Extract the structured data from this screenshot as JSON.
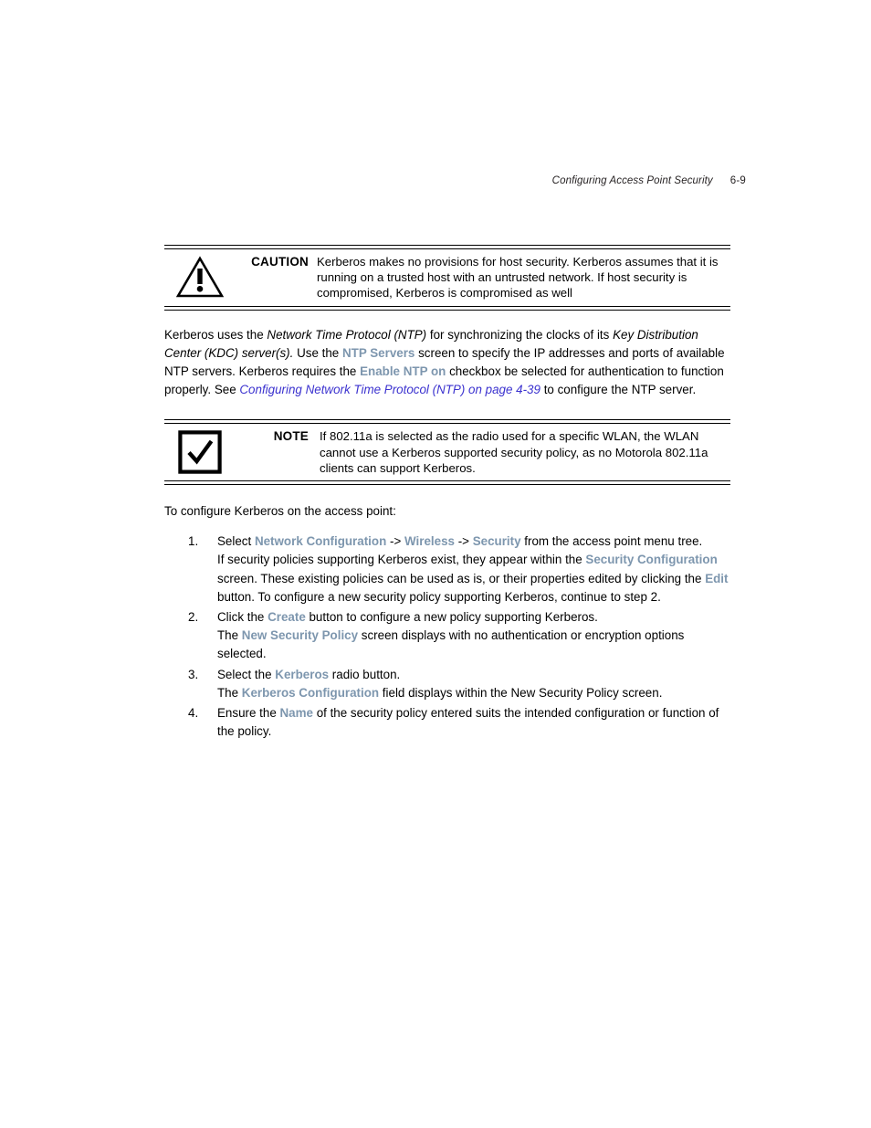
{
  "header": {
    "chapter_title": "Configuring Access Point Security",
    "page_number": "6-9"
  },
  "colors": {
    "ui_term": "#7d96ae",
    "cross_reference": "#3b32cf",
    "text": "#000000",
    "rule": "#000000"
  },
  "caution": {
    "icon": "warning-triangle-icon",
    "label": "CAUTION",
    "text": "Kerberos makes no provisions for host security. Kerberos assumes that it is running on a trusted host with an untrusted network. If host security is compromised, Kerberos is compromised as well"
  },
  "note": {
    "icon": "checkmark-box-icon",
    "label": "NOTE",
    "text": "If 802.11a is selected as the radio used for a specific WLAN, the WLAN cannot use a Kerberos supported security policy, as no Motorola 802.11a clients can support Kerberos."
  },
  "ntp_paragraph": {
    "seg1": "Kerberos uses the ",
    "em1": "Network Time Protocol (NTP)",
    "seg2": " for synchronizing the clocks of its ",
    "em2": "Key Distribution Center (KDC) server(s).",
    "seg3": " Use the ",
    "ui1": "NTP Servers",
    "seg4": " screen to specify the IP addresses and ports of available NTP servers. Kerberos requires the ",
    "ui2": "Enable NTP on",
    "seg5": " checkbox be selected for authentication to function properly. See ",
    "xref1": "Configuring Network Time Protocol (NTP) on page 4-39",
    "seg6": " to configure the NTP server."
  },
  "intro": "To configure Kerberos on the access point:",
  "steps": [
    {
      "number": "1.",
      "paragraphs": [
        {
          "seg1": "Select ",
          "ui1": "Network Configuration",
          "seg2": " -> ",
          "ui2": "Wireless",
          "seg3": " -> ",
          "ui3": "Security",
          "seg4": " from the access point menu tree."
        },
        {
          "seg1": "If security policies supporting Kerberos exist, they appear within the ",
          "ui1": "Security Configuration",
          "seg2": " screen. These existing policies can be used as is, or their properties edited by clicking the ",
          "ui2": "Edit",
          "seg3": " button. To configure a new security policy supporting Kerberos, continue to step 2."
        }
      ]
    },
    {
      "number": "2.",
      "paragraphs": [
        {
          "seg1": "Click the ",
          "ui1": "Create",
          "seg2": " button to configure a new policy supporting Kerberos."
        },
        {
          "seg1": "The ",
          "ui1": "New Security Policy",
          "seg2": " screen displays with no authentication or encryption options selected."
        }
      ]
    },
    {
      "number": "3.",
      "paragraphs": [
        {
          "seg1": "Select the ",
          "ui1": "Kerberos",
          "seg2": " radio button."
        },
        {
          "seg1": "The ",
          "ui1": "Kerberos Configuration",
          "seg2": " field displays within the New Security Policy screen."
        }
      ]
    },
    {
      "number": "4.",
      "paragraphs": [
        {
          "seg1": "Ensure the ",
          "ui1": "Name",
          "seg2": " of the security policy entered suits the intended configuration or function of the policy."
        }
      ]
    }
  ]
}
